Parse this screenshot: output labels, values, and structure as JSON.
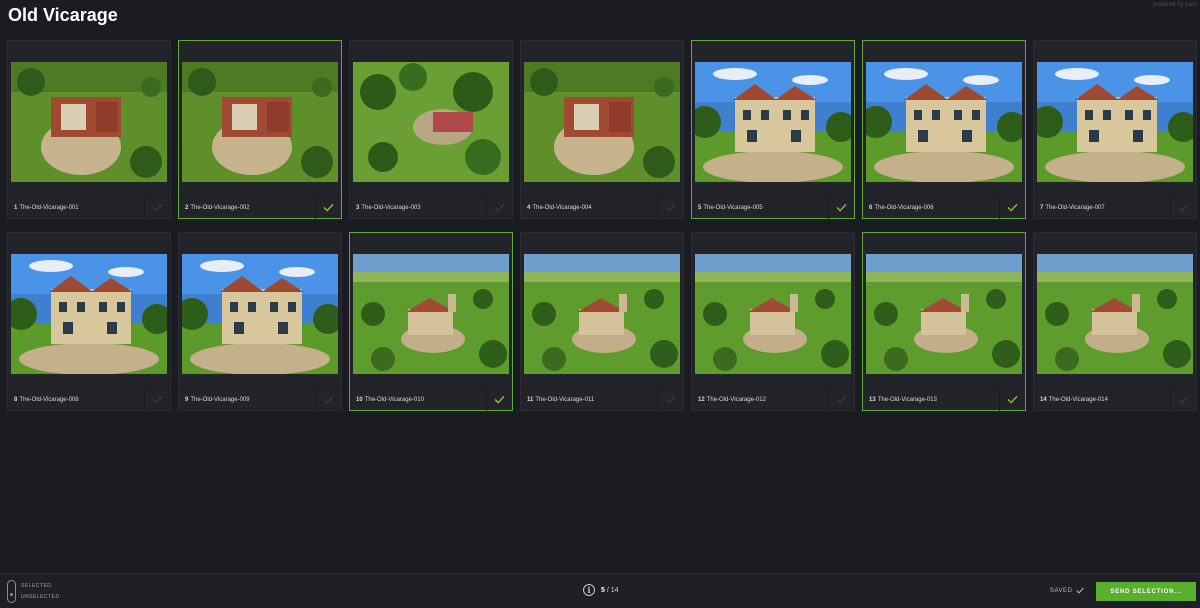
{
  "header": {
    "title": "Old Vicarage",
    "powered_by": "powered by pass"
  },
  "colors": {
    "background": "#1b1c21",
    "card": "#23242a",
    "selected_border": "#5fa83a",
    "check_selected": "#7cc242",
    "accent_button": "#5ab02e"
  },
  "photos": [
    {
      "num": "1",
      "name": "The-Old-Vicarage-001",
      "selected": false,
      "scene": "aerial-topdown"
    },
    {
      "num": "2",
      "name": "The-Old-Vicarage-002",
      "selected": true,
      "scene": "aerial-topdown"
    },
    {
      "num": "3",
      "name": "The-Old-Vicarage-003",
      "selected": false,
      "scene": "aerial-garden"
    },
    {
      "num": "4",
      "name": "The-Old-Vicarage-004",
      "selected": false,
      "scene": "aerial-topdown"
    },
    {
      "num": "5",
      "name": "The-Old-Vicarage-005",
      "selected": true,
      "scene": "house-front"
    },
    {
      "num": "6",
      "name": "The-Old-Vicarage-006",
      "selected": true,
      "scene": "house-front"
    },
    {
      "num": "7",
      "name": "The-Old-Vicarage-007",
      "selected": false,
      "scene": "house-front"
    },
    {
      "num": "8",
      "name": "The-Old-Vicarage-008",
      "selected": false,
      "scene": "house-front"
    },
    {
      "num": "9",
      "name": "The-Old-Vicarage-009",
      "selected": false,
      "scene": "house-front"
    },
    {
      "num": "10",
      "name": "The-Old-Vicarage-010",
      "selected": true,
      "scene": "aerial-wide"
    },
    {
      "num": "11",
      "name": "The-Old-Vicarage-011",
      "selected": false,
      "scene": "aerial-wide"
    },
    {
      "num": "12",
      "name": "The-Old-Vicarage-012",
      "selected": false,
      "scene": "aerial-wide"
    },
    {
      "num": "13",
      "name": "The-Old-Vicarage-013",
      "selected": true,
      "scene": "aerial-wide"
    },
    {
      "num": "14",
      "name": "The-Old-Vicarage-014",
      "selected": false,
      "scene": "aerial-wide"
    }
  ],
  "footer": {
    "legend_selected": "SELECTED",
    "legend_unselected": "UNSELECTED",
    "info_icon": "info-icon",
    "selected_count": "5",
    "total_count": "/ 14",
    "saved_label": "SAVED",
    "send_button_label": "SEND SELECTION..."
  }
}
